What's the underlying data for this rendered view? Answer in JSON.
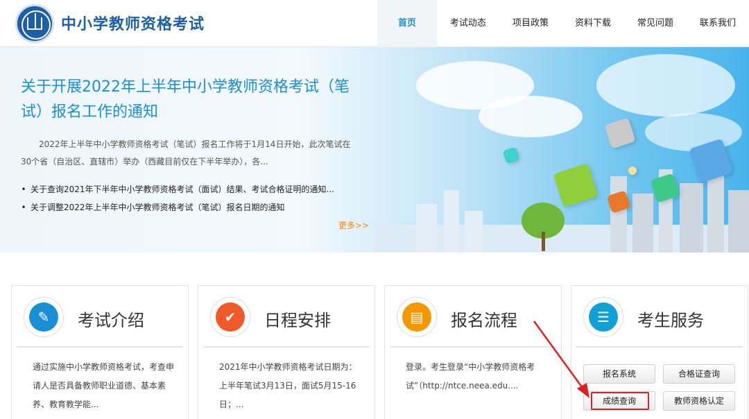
{
  "header": {
    "site_title": "中小学教师资格考试",
    "logo_icon": "emblem-icon",
    "nav": [
      {
        "label": "首页",
        "active": true
      },
      {
        "label": "考试动态",
        "active": false
      },
      {
        "label": "项目政策",
        "active": false
      },
      {
        "label": "资料下载",
        "active": false
      },
      {
        "label": "常见问题",
        "active": false
      },
      {
        "label": "联系我们",
        "active": false
      }
    ]
  },
  "banner": {
    "title": "关于开展2022年上半年中小学教师资格考试（笔试）报名工作的通知",
    "description": "2022年上半年中小学教师资格考试（笔试）报名工作将于1月14日开始，此次笔试在30个省（自治区、直辖市）举办（西藏目前仅在下半年举办），各...",
    "links": [
      "关于查询2021年下半年中小学教师资格考试（面试）结果、考试合格证明的通知...",
      "关于调整2022年上半年中小学教师资格考试（笔试）报名日期的通知"
    ],
    "bullet": "•",
    "more": "更多>>"
  },
  "cards": [
    {
      "title": "考试介绍",
      "icon": "document-edit-icon",
      "color": "#1a8fd6",
      "body": "通过实施中小学教师资格考试，考查申请人是否具备教师职业道德、基本素养、教育教学能..."
    },
    {
      "title": "日程安排",
      "icon": "checkmark-icon",
      "color": "#f05a28",
      "body": "2021年中小学教师资格考试日期为：上半年笔试3月13日，面试5月15-16日；..."
    },
    {
      "title": "报名流程",
      "icon": "browser-form-icon",
      "color": "#f39800",
      "body": "登录。考生登录“中小学教师资格考试”（http://ntce.neea.edu...."
    },
    {
      "title": "考生服务",
      "icon": "contact-book-icon",
      "color": "#0fa0d6",
      "body": ""
    }
  ],
  "services": {
    "buttons": [
      "报名系统",
      "合格证查询",
      "成绩查询",
      "教师资格认定"
    ],
    "highlighted": "成绩查询",
    "highlight_color": "#e02020"
  },
  "colors": {
    "brand_blue": "#1d5fa6",
    "accent_blue": "#1a8fd6",
    "more_orange": "#f08a00"
  }
}
